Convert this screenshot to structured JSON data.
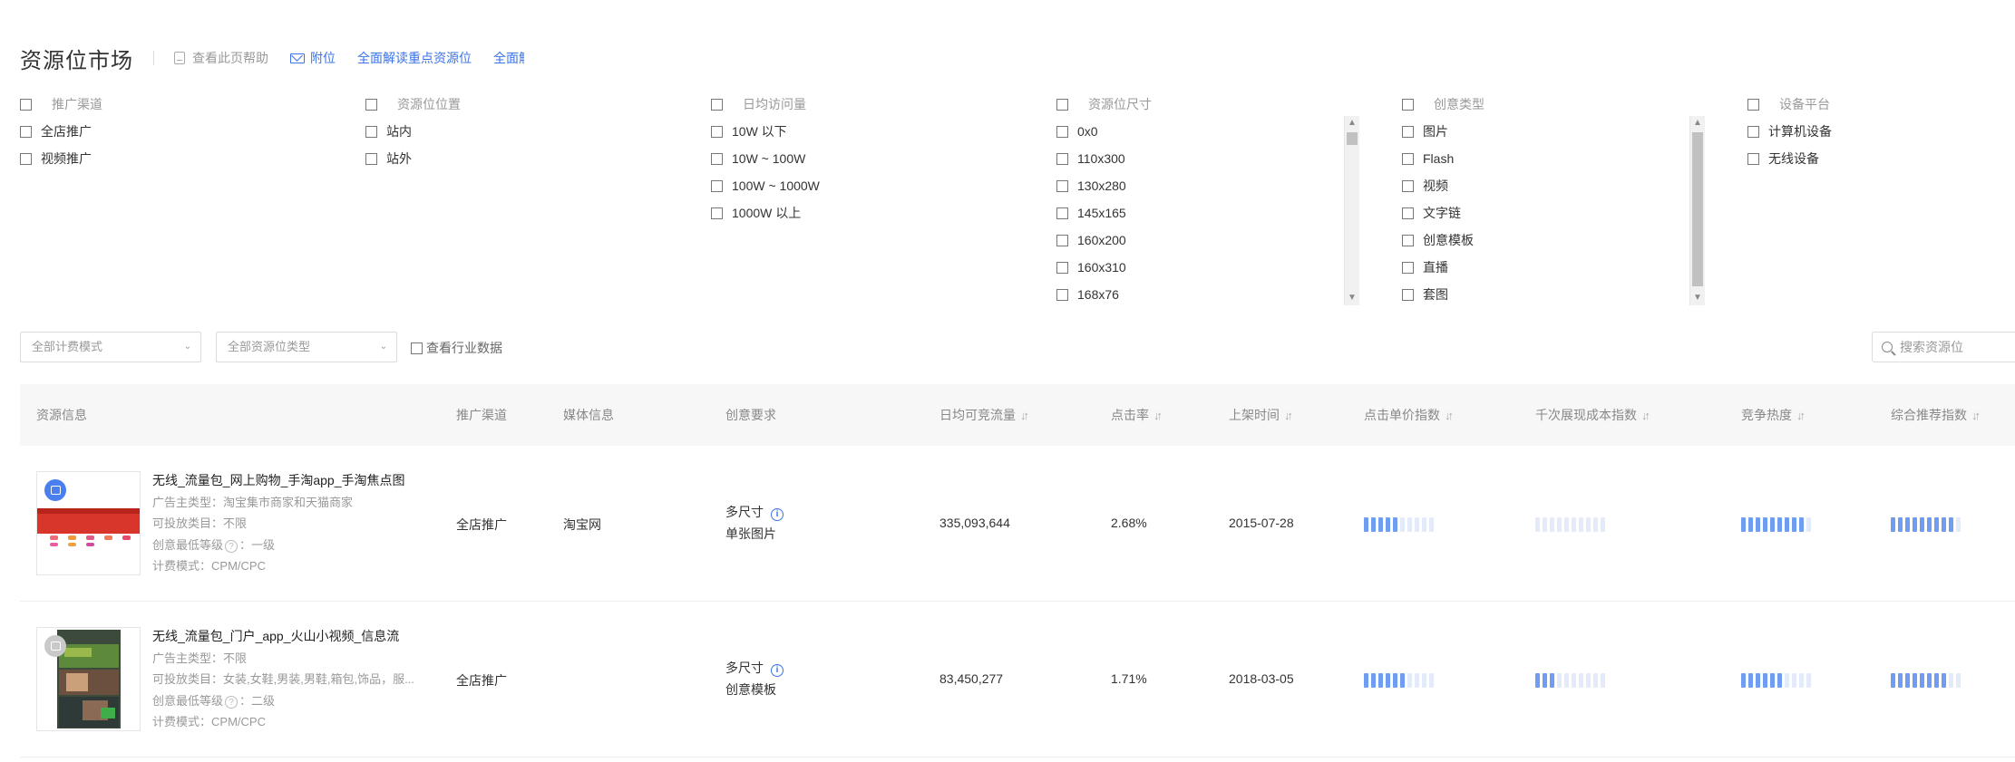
{
  "header": {
    "title": "资源位市场",
    "help_label": "查看此页帮助",
    "link_mail": "附位",
    "link_guide": "全面解读重点资源位",
    "link_more": "全面解"
  },
  "filters": {
    "channel": {
      "title": "推广渠道",
      "options": [
        "全店推广",
        "视频推广"
      ]
    },
    "position": {
      "title": "资源位位置",
      "options": [
        "站内",
        "站外"
      ]
    },
    "traffic": {
      "title": "日均访问量",
      "options": [
        "10W 以下",
        "10W ~ 100W",
        "100W ~ 1000W",
        "1000W 以上"
      ]
    },
    "size": {
      "title": "资源位尺寸",
      "options": [
        "0x0",
        "110x300",
        "130x280",
        "145x165",
        "160x200",
        "160x310",
        "168x76"
      ]
    },
    "creative": {
      "title": "创意类型",
      "options": [
        "图片",
        "Flash",
        "视频",
        "文字链",
        "创意模板",
        "直播",
        "套图"
      ]
    },
    "device": {
      "title": "设备平台",
      "options": [
        "计算机设备",
        "无线设备"
      ]
    }
  },
  "toolbar": {
    "billing_select": "全部计费模式",
    "type_select": "全部资源位类型",
    "industry_checkbox": "查看行业数据",
    "search_placeholder": "搜索资源位"
  },
  "table": {
    "columns": [
      "资源信息",
      "推广渠道",
      "媒体信息",
      "创意要求",
      "日均可竞流量",
      "点击率",
      "上架时间",
      "点击单价指数",
      "千次展现成本指数",
      "竞争热度",
      "综合推荐指数"
    ],
    "rows": [
      {
        "title": "无线_流量包_网上购物_手淘app_手淘焦点图",
        "advertiser_label": "广告主类型：",
        "advertiser": "淘宝集市商家和天猫商家",
        "category_label": "可投放类目：",
        "category": "不限",
        "level_label": "创意最低等级",
        "level": "一级",
        "billing_label": "计费模式：",
        "billing": "CPM/CPC",
        "channel": "全店推广",
        "media": "淘宝网",
        "creative_size": "多尺寸",
        "creative_type": "单张图片",
        "traffic": "335,093,644",
        "ctr": "2.68%",
        "date": "2015-07-28",
        "cpc_index": 5,
        "cpm_index": 0,
        "heat_index": 9,
        "recommend_index": 9
      },
      {
        "title": "无线_流量包_门户_app_火山小视频_信息流",
        "advertiser_label": "广告主类型：",
        "advertiser": "不限",
        "category_label": "可投放类目：",
        "category": "女装,女鞋,男装,男鞋,箱包,饰品，服...",
        "level_label": "创意最低等级",
        "level": "二级",
        "billing_label": "计费模式：",
        "billing": "CPM/CPC",
        "channel": "全店推广",
        "media": "",
        "creative_size": "多尺寸",
        "creative_type": "创意模板",
        "traffic": "83,450,277",
        "ctr": "1.71%",
        "date": "2018-03-05",
        "cpc_index": 6,
        "cpm_index": 3,
        "heat_index": 6,
        "recommend_index": 8
      }
    ]
  },
  "colors": {
    "link": "#3a73e6",
    "bar_on": "#6f9df2",
    "bar_off": "#e3ebfb"
  }
}
